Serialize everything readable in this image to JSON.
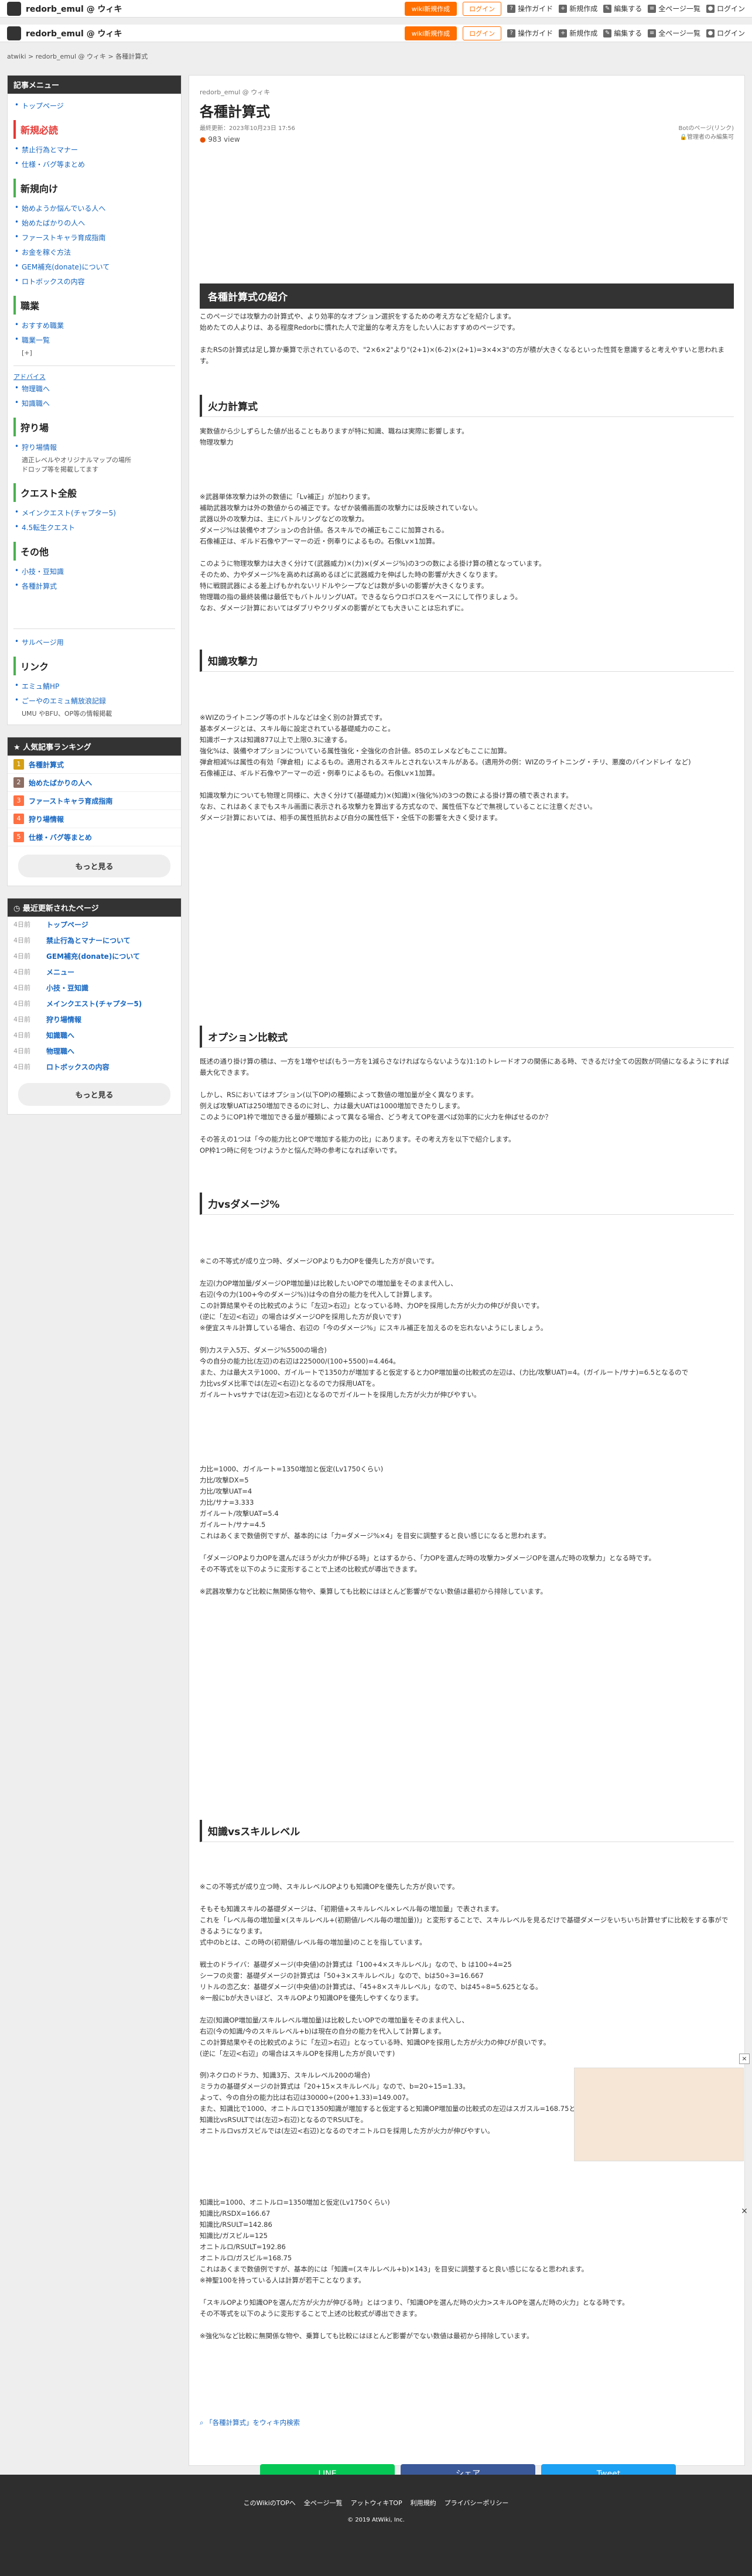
{
  "site": {
    "name": "redorb_emul @ ウィキ"
  },
  "header": {
    "btn_create": "wiki新規作成",
    "btn_login": "ログイン",
    "guide": "操作ガイド",
    "new": "新規作成",
    "edit": "編集する",
    "all_pages": "全ページ一覧",
    "login": "ログイン"
  },
  "breadcrumb": "atwiki > redorb_emul @ ウィキ > 各種計算式",
  "sidebar": {
    "menu_title": "記事メニュー",
    "top_link": "トップページ",
    "sec_beginner": "新規必読",
    "beginner": [
      "禁止行為とマナー",
      "仕様・バグ等まとめ"
    ],
    "sec_new": "新規向け",
    "new_links": [
      "始めようか悩んでいる人へ",
      "始めたばかりの人へ",
      "ファーストキャラ育成指南",
      "お金を稼ぐ方法",
      "GEM補充(donate)について",
      "ロトボックスの内容"
    ],
    "sec_job": "職業",
    "job_links": [
      "おすすめ職業",
      "職業一覧"
    ],
    "advice": "アドバイス",
    "advice_links": [
      "物理職へ",
      "知識職へ"
    ],
    "sec_hunt": "狩り場",
    "hunt_link": "狩り場情報",
    "hunt_note": "適正レベルやオリジナルマップの場所\nドロップ等を掲載してます",
    "sec_quest": "クエスト全般",
    "quest_links": [
      "メインクエスト(チャプター5)",
      "4.5転生クエスト"
    ],
    "sec_other": "その他",
    "other_links": [
      "小技・豆知識",
      "各種計算式"
    ],
    "support_link": "サルベージ用",
    "sec_link": "リンク",
    "links": [
      "エミュ鯖HP",
      "ごーやのエミュ鯖放浪記録"
    ],
    "links_note": "UMU やBFU、OP等の情報掲載",
    "ranking_title": "人気記事ランキング",
    "ranking": [
      "各種計算式",
      "始めたばかりの人へ",
      "ファーストキャラ育成指南",
      "狩り場情報",
      "仕様・バグ等まとめ"
    ],
    "ranking_colors": [
      "#d4a017",
      "#8d6e63",
      "#ff7043",
      "#ff7043",
      "#ff7043"
    ],
    "more": "もっと見る",
    "recent_title": "最近更新されたページ",
    "recent": [
      {
        "d": "4日前",
        "t": "トップページ"
      },
      {
        "d": "4日前",
        "t": "禁止行為とマナーについて"
      },
      {
        "d": "4日前",
        "t": "GEM補充(donate)について"
      },
      {
        "d": "4日前",
        "t": "メニュー"
      },
      {
        "d": "4日前",
        "t": "小技・豆知識"
      },
      {
        "d": "4日前",
        "t": "メインクエスト(チャプター5)"
      },
      {
        "d": "4日前",
        "t": "狩り場情報"
      },
      {
        "d": "4日前",
        "t": "知識職へ"
      },
      {
        "d": "4日前",
        "t": "物理職へ"
      },
      {
        "d": "4日前",
        "t": "ロトボックスの内容"
      }
    ]
  },
  "main": {
    "crumb": "redorb_emul @ ウィキ",
    "title": "各種計算式",
    "updated": "最終更新：2023年10月23日 17:56",
    "meta_right": "Botのページ(リンク)",
    "meta_right2": "管理者のみ編集可",
    "views": "983 view",
    "h_intro": "各種計算式の紹介",
    "p_intro": "このページでは攻撃力の計算式や、より効率的なオプション選択をするための考え方などを紹介します。\n始めたての人よりは、ある程度Redorbに慣れた人で定量的な考え方をしたい人におすすめのページです。\n\nまたRSの計算式は足し算か乗算で示されているので、\"2×6×2\"より\"(2+1)×(6-2)×(2+1)=3×4×3\"の方が積が大きくなるといった性質を意識すると考えやすいと思われます。",
    "h_phys": "火力計算式",
    "p_phys1": "実数値から少しずらした値が出ることもありますが特に知識、職ねは実際に影響します。\n物理攻撃力",
    "p_phys2": "※武器単体攻撃力は外の数値に「Lv補正」が加わります。\n補助武器攻撃力は外の数値からの補正です。なぜか装備画面の攻撃力には反映されていない。\n武器以外の攻撃力は、主にバトルリングなどの攻撃力。\nダメージ%は装備やオプションの合計値。各スキルでの補正もここに加算される。\n石像補正は、ギルド石像やアーマーの近・例奉りによるもの。石像Lv×1加算。\n\nこのように物理攻撃力は大きく分けて(武器威力)×(力)×(ダメージ%)の3つの数による掛け算の積となっています。\nそのため、力やダメージ%を高めれば高めるほどに武器威力を伸ばした時の影響が大きくなります。\n特に戦闘武器による差上げもかれないリドルやシープなどは数が多いの影響が大きくなります。\n物理職の指の最終装備は最低でもバトルリングUAT。できるならウロボロスをベースにして作りましょう。\nなお、ダメージ計算においてはダブリやクリダメの影響がとても大きいことは忘れずに。",
    "h_know": "知識攻撃力",
    "p_know": "※WIZのライトニング等のボトルなどは全く別の計算式です。\n基本ダメージとは、スキル毎に設定されている基礎威力のこと。\n知識ボーナスは知識877以上で上限0.3に達する。\n強化%は、装備やオプションについている属性強化・全強化の合計値。85のエレメなどもここに加算。\n弾倉相減%は属性の有効「弾倉相」によるもの。適用されるスキルとされないスキルがある。(適用外の例：WIZのライトニング・チリ、悪魔のバインドレイ など)\n石像補正は、ギルド石像やアーマーの近・例奉りによるもの。石像Lv×1加算。\n\n知識攻撃力についても物理と同様に、大きく分けて(基礎威力)×(知識)×(強化%)の3つの数による掛け算の積で表されます。\nなお、これはあくまでもスキル画面に表示される攻撃力を算出する方式なので、属性低下などで無視していることに注意ください。\nダメージ計算においては、相手の属性抵抗および自分の属性低下・全低下の影響を大きく受けます。",
    "h_opt": "オプション比較式",
    "p_opt": "既述の通り掛け算の積は、一方を1増やせば(もう一方を1減らさなければならないような)1:1のトレードオフの関係にある時、できるだけ全ての因数が同値になるようにすれば最大化できます。\n\nしかし、RSにおいてはオプション(以下OP)の種類によって数値の増加量が全く異なります。\n例えば攻撃UATは250増加できるのに対し、力は最大UATは1000増加できたりします。\nこのようにOP1枠で増加できる量が種類によって異なる場合、どう考えてOPを選べば効率的に火力を伸ばせるのか？\n\nその答えの1つは「今の能力比とOPで増加する能力の比」にあります。その考え方を以下で紹介します。\nOP枠1つ時に何をつけようかと悩んだ時の参考になれば幸いです。",
    "h_vs1": "力vsダメージ%",
    "p_vs1": "※この不等式が成り立つ時、ダメージOPよりも力OPを優先した方が良いです。\n\n左辺(力OP増加量/ダメージOP増加量)は比較したいOPでの増加量をそのまま代入し、\n右辺(今の力(100+今のダメージ%))は今の自分の能力を代入して計算します。\nこの計算結果やその比較式のように「左辺>右辺」となっている時、力OPを採用した方が火力の伸びが良いです。\n(逆に「左辺<右辺」の場合はダメージOPを採用した方が良いです)\n※便宜スキル計算している場合、右辺の「今のダメージ%」にスキル補正を加えるのを忘れないようにしましょう。\n\n例)力ステ入5万、ダメージ%5500の場合)\n今の自分の能力比(左辺)の右辺は225000/(100+5500)=4.464。\nまた、力は最大ステ1000、ガイルートで1350力が増加すると仮定すると力OP増加量の比較式の左辺は、(力比/攻撃UAT)=4。(ガイルート/サナ)=6.5となるので\n力比vsダメ比率では(左辺<右辺)となるので力採用UATを。\nガイルートvsサナでは(左辺>右辺)となるのでガイルートを採用した方が火力が伸びやすい。",
    "p_vs1b": "力比=1000、ガイルート=1350増加と仮定(Lv1750くらい)\n力比/攻撃DX=5\n力比/攻撃UAT=4\n力比/サナ=3.333\nガイルート/攻撃UAT=5.4\nガイルート/サナ=4.5\nこれはあくまで数値例ですが、基本的には「力=ダメージ%×4」を目安に調整すると良い感じになると思われます。\n\n「ダメージOPより力OPを選んだほうが火力が伸びる時」とはするから、「力OPを選んだ時の攻撃力>ダメージOPを選んだ時の攻撃力」となる時です。\nその不等式を以下のように変形することで上述の比較式が導出できます。\n\n※武器攻撃力など比較に無関係な物や、乗算しても比較にはほとんど影響がでない数値は最初から排除しています。",
    "h_vs2": "知識vsスキルレベル",
    "p_vs2": "※この不等式が成り立つ時、スキルレベルOPよりも知識OPを優先した方が良いです。\n\nそもそも知識スキルの基礎ダメージは、「初期値+スキルレベル×レベル毎の増加量」で表されます。\nこれを「レベル毎の増加量×(スキルレベル+(初期値/レベル毎の増加量))」と変形することで、スキルレベルを見るだけで基礎ダメージをいちいち計算せずに比較をする事ができるようになります。\n式中のbとは、この時の(初期値/レベル毎の増加量)のことを指しています。\n\n戦士のドライバ：基礎ダメージ(中央値)の計算式は「100+4×スキルレベル」なので、b は100÷4=25\nシーフの炎雷：基礎ダメージの計算式は「50+3×スキルレベル」なので、bは50÷3=16.667\nリトルの恋乙女：基礎ダメージ(中央値)の計算式は、「45+8×スキルレベル」なので、bは45÷8=5.625となる。\n※一般にbが大きいほど、スキルOPより知識OPを優先しやすくなります。\n\n左辺(知識OP増加量/スキルレベル増加量)は比較したいOPでの増加量をそのまま代入し、\n右辺(今の知識/今のスキルレベル+b)は現在の自分の能力を代入して計算します。\nこの計算結果やその比較式のように「左辺>右辺」となっている時、知識OPを採用した方が火力の伸びが良いです。\n(逆に「左辺<右辺」の場合はスキルOPを採用した方が良いです)\n\n例)ネクロのドラカ、知識3万、スキルレベル200の場合)\nミラカの基礎ダメージの計算式は「20+15×スキルレベル」なので、b=20÷15=1.33。\nよって、今の自分の能力比は右辺は30000÷(200+1.33)=149.007。\nまた、知識比で1000、オニトルロで1350知識が増加すると仮定すると知識OP増加量の比較式の左辺はスガスル=168.75となるので\n知識比vsRSULTでは(左辺>右辺)となるのでRSULTを。\nオニトルロvsガスビルでは(左辺<右辺)となるのでオニトルロを採用した方が火力が伸びやすい。",
    "p_vs2b": "知識比=1000、オニトルロ=1350増加と仮定(Lv1750くらい)\n知識比/RSDX=166.67\n知識比/RSULT=142.86\n知識比/ガスビル=125\nオニトルロ/RSULT=192.86\nオニトルロ/ガスビル=168.75\nこれはあくまで数値例ですが、基本的には「知識=(スキルレベル+b)×143」を目安に調整すると良い感じになると思われます。\n※神聖100を持っている人は計算が若干ことなります。\n\n「スキルOPより知識OPを選んだ方が火力が伸びる時」とはつまり、「知識OPを選んだ時の火力>スキルOPを選んだ時の火力」となる時です。\nその不等式を以下のように変形することで上述の比較式が導出できます。\n\n※強化%など比較に無関係な物や、乗算しても比較にはほとんど影響がでない数値は最初から排除しています。",
    "search_link": "「各種計算式」をウィキ内検索"
  },
  "share": {
    "line": "LINE",
    "share": "シェア",
    "tweet": "Tweet"
  },
  "footer": {
    "links": [
      "このWikiのTOPへ",
      "全ページ一覧",
      "アットウィキTOP",
      "利用規約",
      "プライバシーポリシー"
    ],
    "copy": "2019 AtWiki, Inc."
  }
}
